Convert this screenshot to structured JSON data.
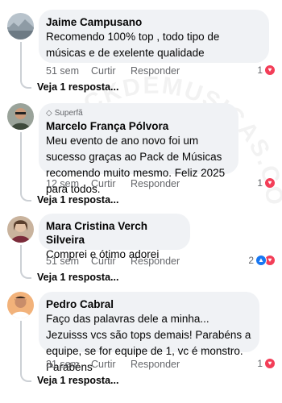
{
  "comments": [
    {
      "author": "Jaime Campusano",
      "badge": "",
      "text": "Recomendo 100% top , todo tipo de músicas e de exelente qualidade",
      "age": "51 sem",
      "like_label": "Curtir",
      "reply_label": "Responder",
      "reaction_count": "1",
      "replies_label": "Veja 1 resposta..."
    },
    {
      "author": "Marcelo França Pólvora",
      "badge": "Superfã",
      "text": "Meu evento de ano novo foi um sucesso graças ao Pack de Músicas recomendo muito mesmo. Feliz 2025 para todos.",
      "age": "12 sem",
      "like_label": "Curtir",
      "reply_label": "Responder",
      "reaction_count": "1",
      "replies_label": "Veja 1 resposta..."
    },
    {
      "author": "Mara Cristina Verch Silveira",
      "badge": "",
      "text": "Comprei e ótimo adorei",
      "age": "51 sem",
      "like_label": "Curtir",
      "reply_label": "Responder",
      "reaction_count": "2",
      "replies_label": "Veja 1 resposta..."
    },
    {
      "author": "Pedro Cabral",
      "badge": "",
      "text": "Faço das palavras dele a minha... Jezuisss vcs são tops demais! Parabéns a equipe, se for equipe de 1, vc é monstro. Parabéns",
      "age": "31 sem",
      "like_label": "Curtir",
      "reply_label": "Responder",
      "reaction_count": "1",
      "replies_label": "Veja 1 resposta..."
    }
  ],
  "watermark": "PACKDEMUSICAS.COM.BR",
  "colors": {
    "bubble": "#f0f2f5",
    "meta_text": "#65676b",
    "love": "#f33e58",
    "like": "#1877f2"
  },
  "icons": {
    "love": "heart-icon",
    "like": "thumbs-up-icon",
    "badge": "diamond-icon"
  }
}
